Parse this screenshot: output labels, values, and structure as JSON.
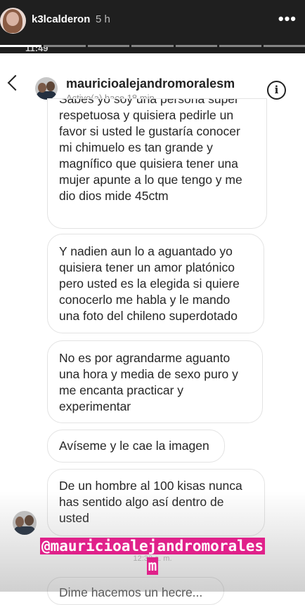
{
  "story": {
    "username": "k3lcalderon",
    "time": "5 h",
    "more": "•••",
    "segments": 7,
    "segments_done": 1
  },
  "inner_status": {
    "time": "11:49"
  },
  "dm": {
    "username": "mauricioalejandromoralesm",
    "status": "Activo(a) hace 18 min",
    "info_glyph": "i"
  },
  "messages": [
    {
      "text": "Sabes yo soy una persona super respetuosa y quisiera pedirle un favor si usted le gustaría conocer mi chimuelo es tan grande y magnífico que quisiera tener una mujer apunte a lo que tengo y me dio dios mide 45ctm"
    },
    {
      "text": "Y nadien aun lo a aguantado  yo quisiera tener un amor platónico pero usted es la elegida si quiere conocerlo me habla y le mando una foto del chileno superdotado"
    },
    {
      "text": "No es por agrandarme aguanto una hora y media de sexo puro y me encanta practicar y experimentar"
    },
    {
      "text": "Avíseme y le cae la imagen"
    },
    {
      "text": "De un hombre al 100 kisas nunca has sentido algo así dentro de usted"
    },
    {
      "text": "Dime hacemos un hecre..."
    }
  ],
  "timestamp": "12:32 a. m.",
  "mention": {
    "line1": "@mauricioalejandromorales",
    "line2": "m",
    "color": "#e0218a"
  }
}
